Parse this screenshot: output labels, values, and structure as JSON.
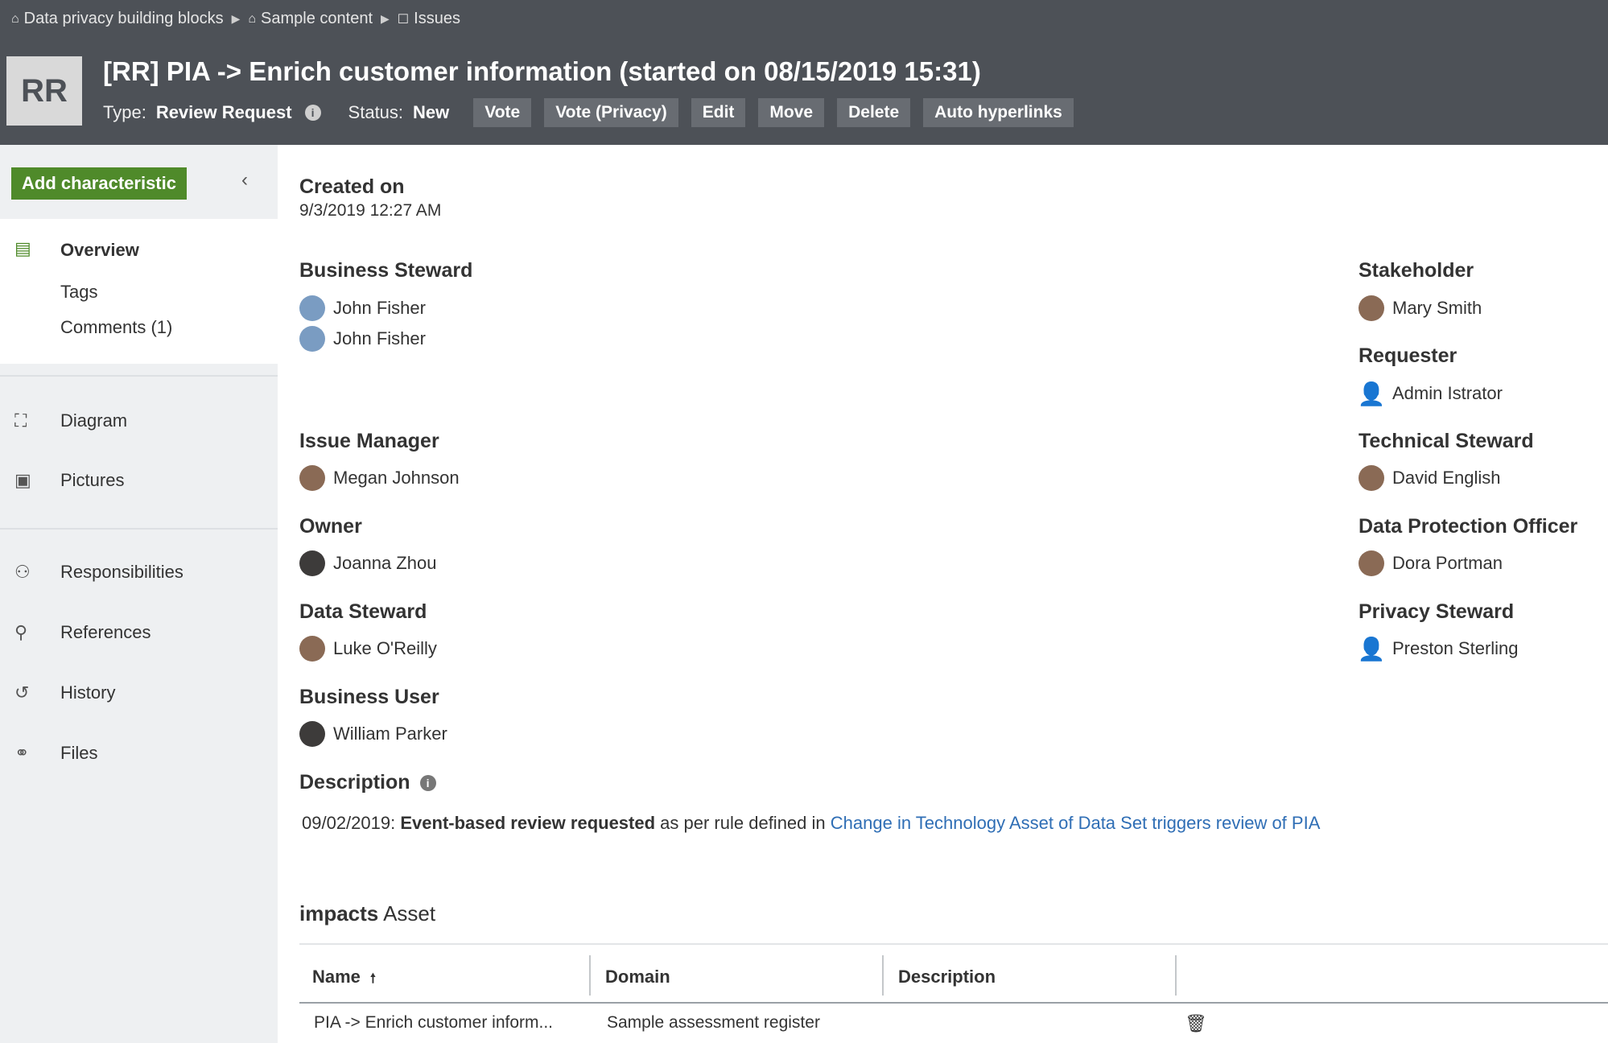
{
  "breadcrumb": {
    "items": [
      "Data privacy building blocks",
      "Sample content",
      "Issues"
    ]
  },
  "header": {
    "avatar_text": "RR",
    "title": "[RR] PIA -> Enrich customer information (started on 08/15/2019 15:31)",
    "type_label": "Type:",
    "type_value": "Review Request",
    "status_label": "Status:",
    "status_value": "New",
    "buttons": [
      "Vote",
      "Vote (Privacy)",
      "Edit",
      "Move",
      "Delete",
      "Auto hyperlinks"
    ]
  },
  "sidebar": {
    "add_button": "Add characteristic",
    "overview": "Overview",
    "tags": "Tags",
    "comments": "Comments (1)",
    "diagram": "Diagram",
    "pictures": "Pictures",
    "responsibilities": "Responsibilities",
    "references": "References",
    "history": "History",
    "files": "Files"
  },
  "main": {
    "created_on_label": "Created on",
    "created_on_value": "9/3/2019 12:27 AM",
    "business_steward_label": "Business Steward",
    "business_stewards": [
      "John Fisher",
      "John Fisher"
    ],
    "issue_manager_label": "Issue Manager",
    "issue_manager": "Megan Johnson",
    "owner_label": "Owner",
    "owner": "Joanna Zhou",
    "data_steward_label": "Data Steward",
    "data_steward": "Luke O'Reilly",
    "business_user_label": "Business User",
    "business_user": "William Parker",
    "stakeholder_label": "Stakeholder",
    "stakeholder": "Mary Smith",
    "requester_label": "Requester",
    "requester": "Admin Istrator",
    "technical_steward_label": "Technical Steward",
    "technical_steward": "David English",
    "dpo_label": "Data Protection Officer",
    "dpo": "Dora Portman",
    "privacy_steward_label": "Privacy Steward",
    "privacy_steward": "Preston Sterling",
    "description_label": "Description",
    "description_date": "09/02/2019:",
    "description_bold": "Event-based review requested",
    "description_text": "as per rule defined in",
    "description_link": "Change in Technology Asset of Data Set triggers review of PIA",
    "impacts_bold": "impacts",
    "impacts_text": "Asset"
  },
  "table": {
    "columns": [
      "Name",
      "Domain",
      "Description"
    ],
    "sort_indicator": "🠕",
    "rows": [
      {
        "name": "PIA -> Enrich customer inform...",
        "domain": "Sample assessment register",
        "description": ""
      }
    ]
  }
}
